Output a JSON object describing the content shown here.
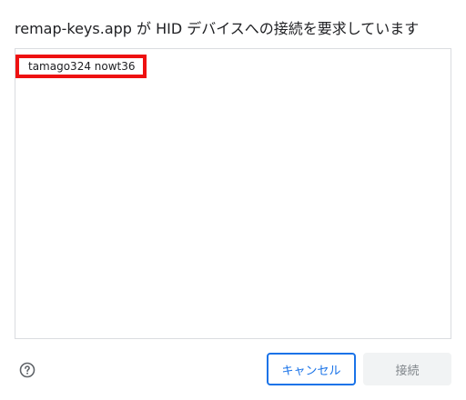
{
  "dialog": {
    "title": "remap-keys.app が HID デバイスへの接続を要求しています"
  },
  "device_list": {
    "items": [
      {
        "label": "tamago324 nowt36",
        "selected_highlight_color": "#ee1111"
      }
    ]
  },
  "footer": {
    "help_icon": "help-circle-icon",
    "cancel_label": "キャンセル",
    "connect_label": "接続",
    "connect_disabled": true
  },
  "colors": {
    "accent": "#1a73e8",
    "highlight_border": "#ee1111",
    "disabled_bg": "#f1f3f4",
    "disabled_text": "#80868b"
  }
}
